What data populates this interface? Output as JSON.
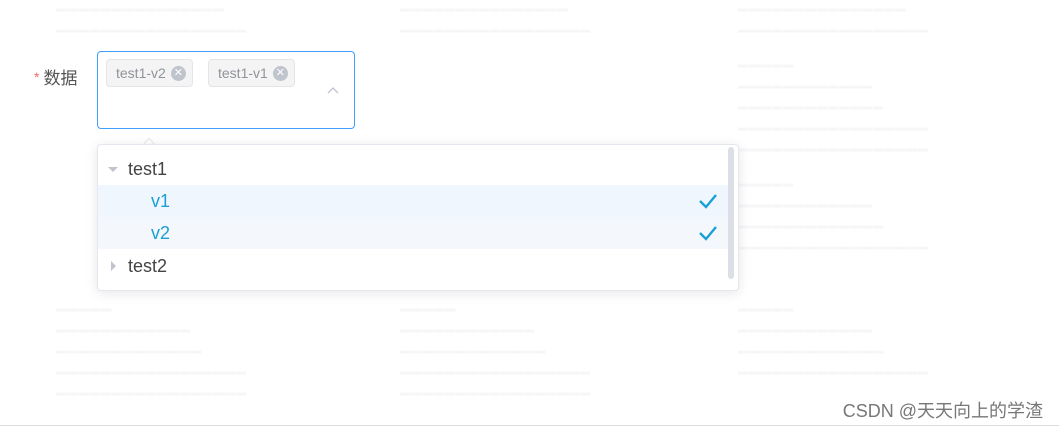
{
  "form": {
    "required_mark": "*",
    "label": "数据"
  },
  "select": {
    "tags": [
      {
        "label": "test1-v2"
      },
      {
        "label": "test1-v1"
      }
    ],
    "tag_close_glyph": "✕",
    "arrow_icon": "chevron-up-icon",
    "accent_color": "#409eff"
  },
  "tree": {
    "nodes": [
      {
        "label": "test1",
        "expanded": true,
        "level": 1
      },
      {
        "label": "v1",
        "selected": true,
        "level": 2
      },
      {
        "label": "v2",
        "selected": true,
        "level": 2
      },
      {
        "label": "test2",
        "expanded": false,
        "level": 1
      }
    ],
    "selected_color": "#1a9fd6"
  },
  "watermark": "CSDN @天天向上的学渣"
}
